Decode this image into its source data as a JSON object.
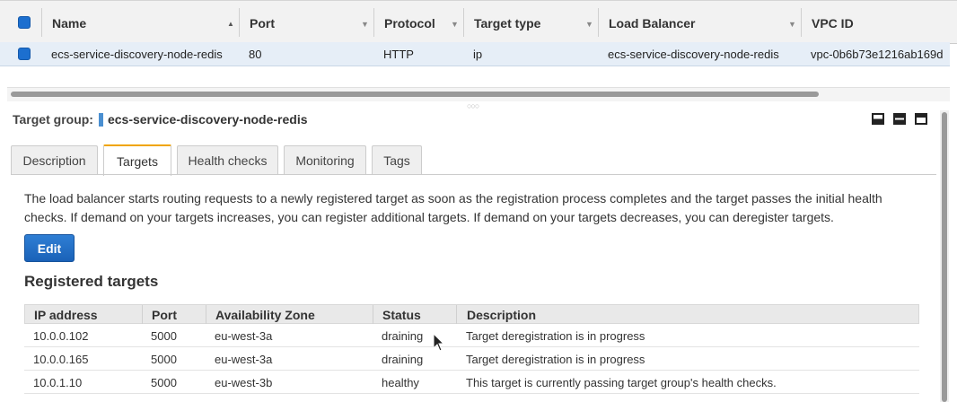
{
  "top_table": {
    "columns": [
      "Name",
      "Port",
      "Protocol",
      "Target type",
      "Load Balancer",
      "VPC ID"
    ],
    "row": {
      "name": "ecs-service-discovery-node-redis",
      "port": "80",
      "protocol": "HTTP",
      "target_type": "ip",
      "load_balancer": "ecs-service-discovery-node-redis",
      "vpc_id": "vpc-0b6b73e1216ab169d"
    }
  },
  "detail": {
    "title_label": "Target group:",
    "title_value": "ecs-service-discovery-node-redis",
    "tabs": [
      "Description",
      "Targets",
      "Health checks",
      "Monitoring",
      "Tags"
    ],
    "active_tab": "Targets",
    "description": "The load balancer starts routing requests to a newly registered target as soon as the registration process completes and the target passes the initial health checks. If demand on your targets increases, you can register additional targets. If demand on your targets decreases, you can deregister targets.",
    "edit_label": "Edit",
    "registered_title": "Registered targets"
  },
  "targets_table": {
    "columns": [
      "IP address",
      "Port",
      "Availability Zone",
      "Status",
      "Description"
    ],
    "rows": [
      {
        "ip": "10.0.0.102",
        "port": "5000",
        "az": "eu-west-3a",
        "status": "draining",
        "description": "Target deregistration is in progress"
      },
      {
        "ip": "10.0.0.165",
        "port": "5000",
        "az": "eu-west-3a",
        "status": "draining",
        "description": "Target deregistration is in progress"
      },
      {
        "ip": "10.0.1.10",
        "port": "5000",
        "az": "eu-west-3b",
        "status": "healthy",
        "description": "This target is currently passing target group's health checks."
      }
    ]
  },
  "colors": {
    "accent_blue": "#1c6fcf",
    "selected_row": "#e6eef7",
    "active_tab_border": "#f0a400"
  },
  "icons": [
    "checkbox-icon",
    "sort-up-icon",
    "dropdown-icon",
    "layout-icon",
    "mouse-cursor-icon"
  ]
}
